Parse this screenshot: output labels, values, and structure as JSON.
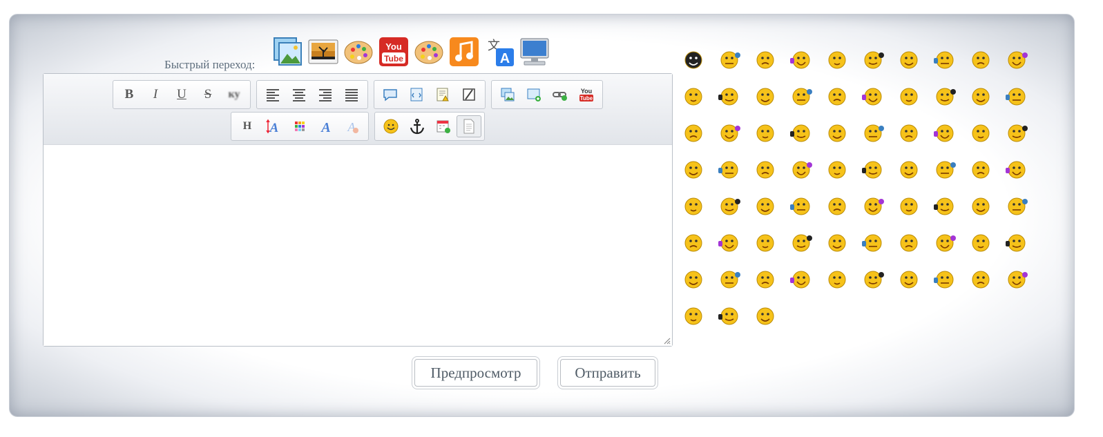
{
  "quick_nav": {
    "label": "Быстрый переход:",
    "icons": [
      "image-gallery-icon",
      "landscape-photo-icon",
      "palette-icon",
      "youtube-icon",
      "palette-icon",
      "music-note-icon",
      "translate-icon",
      "computer-monitor-icon"
    ]
  },
  "toolbar": {
    "bold": "B",
    "italic": "I",
    "underline": "U",
    "strike": "S",
    "blur": "ку",
    "heading": "H"
  },
  "buttons": {
    "preview": "Предпросмотр",
    "submit": "Отправить"
  },
  "smileys_count": 73,
  "colors": {
    "smiley_yellow": "#f6c21a",
    "youtube_red": "#d62b25",
    "music_orange": "#f7891d",
    "text_gray": "#5f6f7e"
  }
}
